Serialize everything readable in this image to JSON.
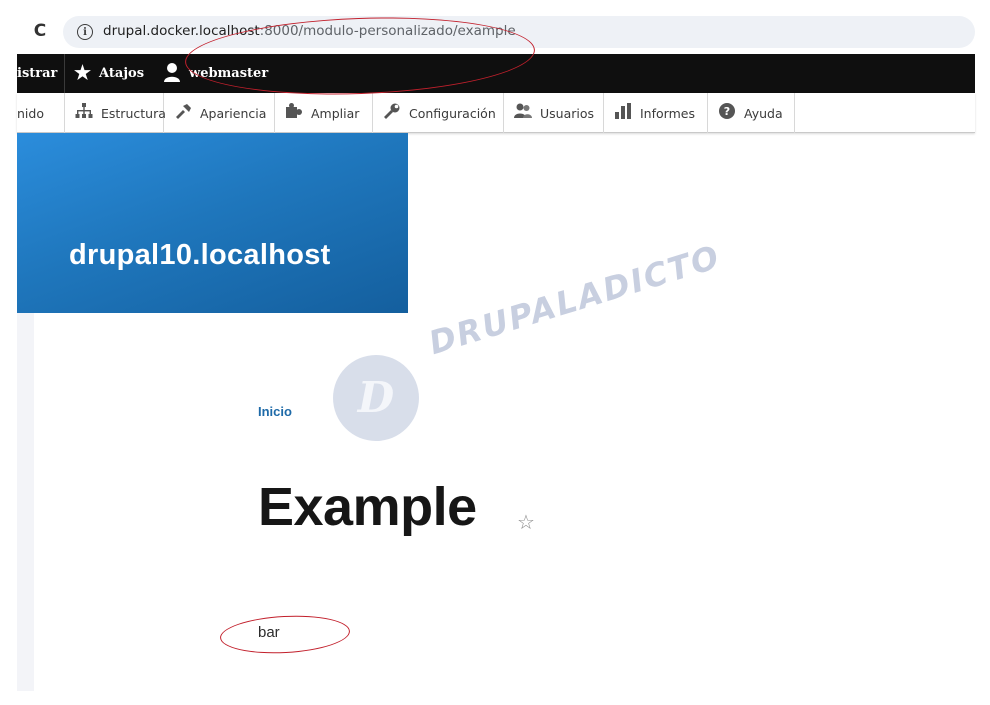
{
  "browser": {
    "reload_icon": "C",
    "info_icon": "i",
    "url_host": "drupal.docker.localhost",
    "url_path": ":8000/modulo-personalizado/example"
  },
  "admin_toolbar": {
    "manage_label": "istrar",
    "shortcuts_label": "Atajos",
    "user_label": "webmaster"
  },
  "tray_menu": {
    "items": [
      {
        "label": "nido",
        "icon": "content-icon"
      },
      {
        "label": "Estructura",
        "icon": "structure-icon"
      },
      {
        "label": "Apariencia",
        "icon": "appearance-icon"
      },
      {
        "label": "Ampliar",
        "icon": "extend-icon"
      },
      {
        "label": "Configuración",
        "icon": "wrench-icon"
      },
      {
        "label": "Usuarios",
        "icon": "users-icon"
      },
      {
        "label": "Informes",
        "icon": "reports-icon"
      },
      {
        "label": "Ayuda",
        "icon": "help-icon"
      }
    ]
  },
  "site": {
    "name": "drupal10.localhost"
  },
  "watermark": {
    "text": "DRUPALADICTO",
    "logo_letter": "D"
  },
  "breadcrumb": {
    "home_label": "Inicio"
  },
  "page": {
    "title": "Example",
    "body": "bar"
  },
  "colors": {
    "brand_blue": "#1f77bd",
    "toolbar_black": "#0f0f0f",
    "annotation_red": "#c2202c",
    "link_blue": "#1e6aa8"
  }
}
